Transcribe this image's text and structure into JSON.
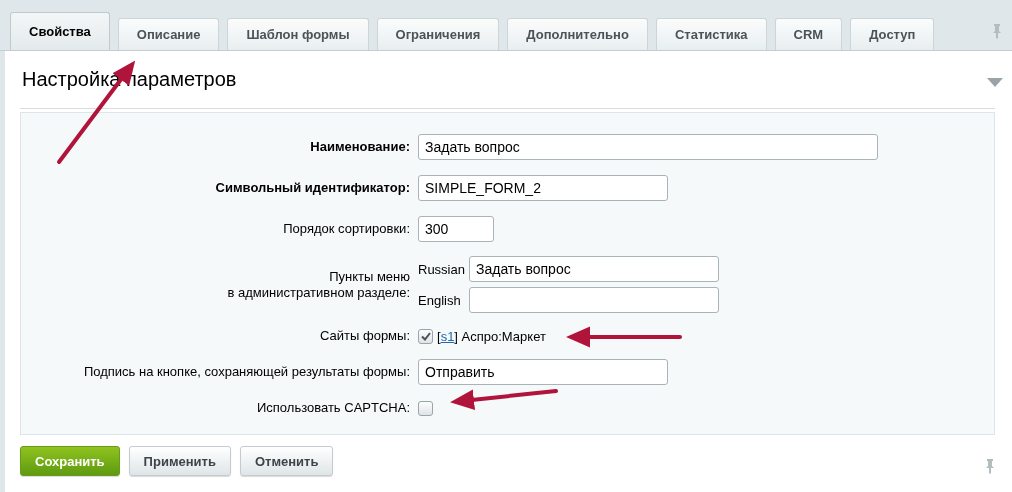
{
  "tabs": [
    {
      "label": "Свойства",
      "selected": true
    },
    {
      "label": "Описание",
      "selected": false
    },
    {
      "label": "Шаблон формы",
      "selected": false
    },
    {
      "label": "Ограничения",
      "selected": false
    },
    {
      "label": "Дополнительно",
      "selected": false
    },
    {
      "label": "Статистика",
      "selected": false
    },
    {
      "label": "CRM",
      "selected": false
    },
    {
      "label": "Доступ",
      "selected": false
    }
  ],
  "section": {
    "title": "Настройка параметров",
    "expanded": true
  },
  "fields": [
    {
      "kind": "text",
      "label": "Наименование:",
      "required": true,
      "value": "Задать вопрос"
    },
    {
      "kind": "text",
      "label": "Символьный идентификатор:",
      "required": true,
      "value": "SIMPLE_FORM_2"
    },
    {
      "kind": "text",
      "label": "Порядок сортировки:",
      "required": false,
      "value": "300"
    },
    {
      "kind": "multilang",
      "label": "Пункты меню\nв административном разделе:",
      "required": false,
      "entries": [
        {
          "lang": "Russian",
          "value": "Задать вопрос"
        },
        {
          "lang": "English"
        }
      ]
    },
    {
      "kind": "sites",
      "label": "Сайты формы:",
      "required": false,
      "items": [
        {
          "checked": true,
          "open": "[",
          "code": "s1",
          "rest": "] Аспро:Маркет"
        }
      ]
    },
    {
      "kind": "text",
      "label": "Подпись на кнопке, сохраняющей результаты формы:",
      "required": false,
      "value": "Отправить"
    },
    {
      "kind": "checkbox",
      "label": "Использовать CAPTCHA:",
      "required": false,
      "checked": false
    }
  ],
  "buttons": [
    {
      "kind": "primary",
      "label": "Сохранить"
    },
    {
      "kind": "normal",
      "label": "Применить"
    },
    {
      "kind": "normal",
      "label": "Отменить"
    }
  ]
}
